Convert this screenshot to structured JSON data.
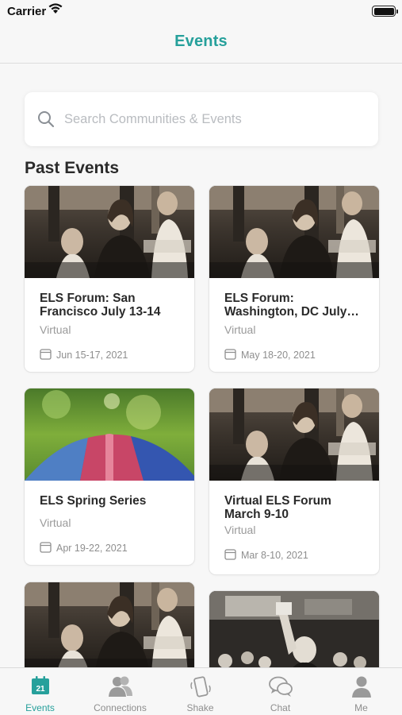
{
  "status_bar": {
    "carrier": "Carrier"
  },
  "nav": {
    "title": "Events"
  },
  "search": {
    "placeholder": "Search Communities & Events"
  },
  "section": {
    "title": "Past Events"
  },
  "events": [
    {
      "title": "ELS Forum: San Francisco July 13-14",
      "location": "Virtual",
      "dates": "Jun 15-17, 2021",
      "image": "conference-photo"
    },
    {
      "title": "ELS Forum: Washington, DC July…",
      "location": "Virtual",
      "dates": "May 18-20, 2021",
      "image": "conference-photo"
    },
    {
      "title": "ELS Spring Series",
      "location": "Virtual",
      "dates": "Apr 19-22, 2021",
      "image": "umbrella-photo"
    },
    {
      "title": "Virtual ELS Forum March 9-10",
      "location": "Virtual",
      "dates": "Mar  8-10, 2021",
      "image": "conference-photo"
    },
    {
      "image": "conference-photo"
    },
    {
      "image": "crowd-selfie-photo"
    }
  ],
  "tabs": [
    {
      "label": "Events",
      "icon": "calendar-icon",
      "badge": "21",
      "active": true
    },
    {
      "label": "Connections",
      "icon": "people-icon"
    },
    {
      "label": "Shake",
      "icon": "shake-phone-icon"
    },
    {
      "label": "Chat",
      "icon": "chat-bubbles-icon"
    },
    {
      "label": "Me",
      "icon": "person-icon"
    }
  ],
  "colors": {
    "accent": "#26a09b",
    "text": "#2a2a2a",
    "muted": "#9a9a9a"
  }
}
